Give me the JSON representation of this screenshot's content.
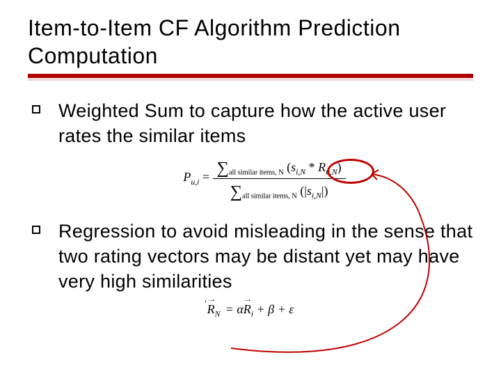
{
  "title": "Item-to-Item CF Algorithm Prediction Computation",
  "bullets": {
    "b1": "Weighted Sum to capture how the active user rates the similar items",
    "b2": "Regression to avoid misleading in the sense that two rating vectors may be distant yet may have very high similarities"
  },
  "formula1": {
    "lhs_P": "P",
    "lhs_sub": "u,i",
    "eq": " = ",
    "sum": "∑",
    "sum_sub": "all similar items, N",
    "lp": "(",
    "s": "s",
    "s_sub": "i,N",
    "star": " * ",
    "R": "R",
    "R_sub": "u,N",
    "rp": ")",
    "abs_l": "(|",
    "abs_r": "|)"
  },
  "formula2": {
    "RN": "R",
    "RN_hat": "′",
    "RN_sub": "N",
    "eq": " = α",
    "Ri": "R",
    "Ri_sub": "i",
    "tail": " + β + ε"
  }
}
